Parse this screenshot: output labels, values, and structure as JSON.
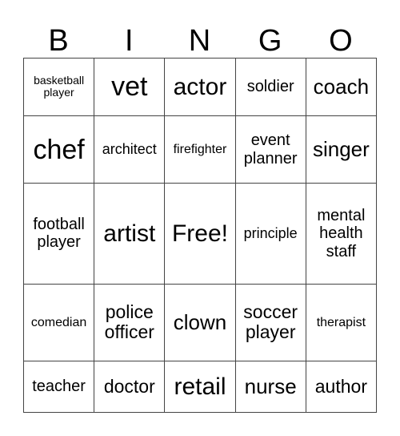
{
  "header": [
    "B",
    "I",
    "N",
    "G",
    "O"
  ],
  "rows": [
    [
      "basketball player",
      "vet",
      "actor",
      "soldier",
      "coach"
    ],
    [
      "chef",
      "architect",
      "firefighter",
      "event planner",
      "singer"
    ],
    [
      "football player",
      "artist",
      "Free!",
      "principle",
      "mental health staff"
    ],
    [
      "comedian",
      "police officer",
      "clown",
      "soccer player",
      "therapist"
    ],
    [
      "teacher",
      "doctor",
      "retail",
      "nurse",
      "author"
    ]
  ]
}
